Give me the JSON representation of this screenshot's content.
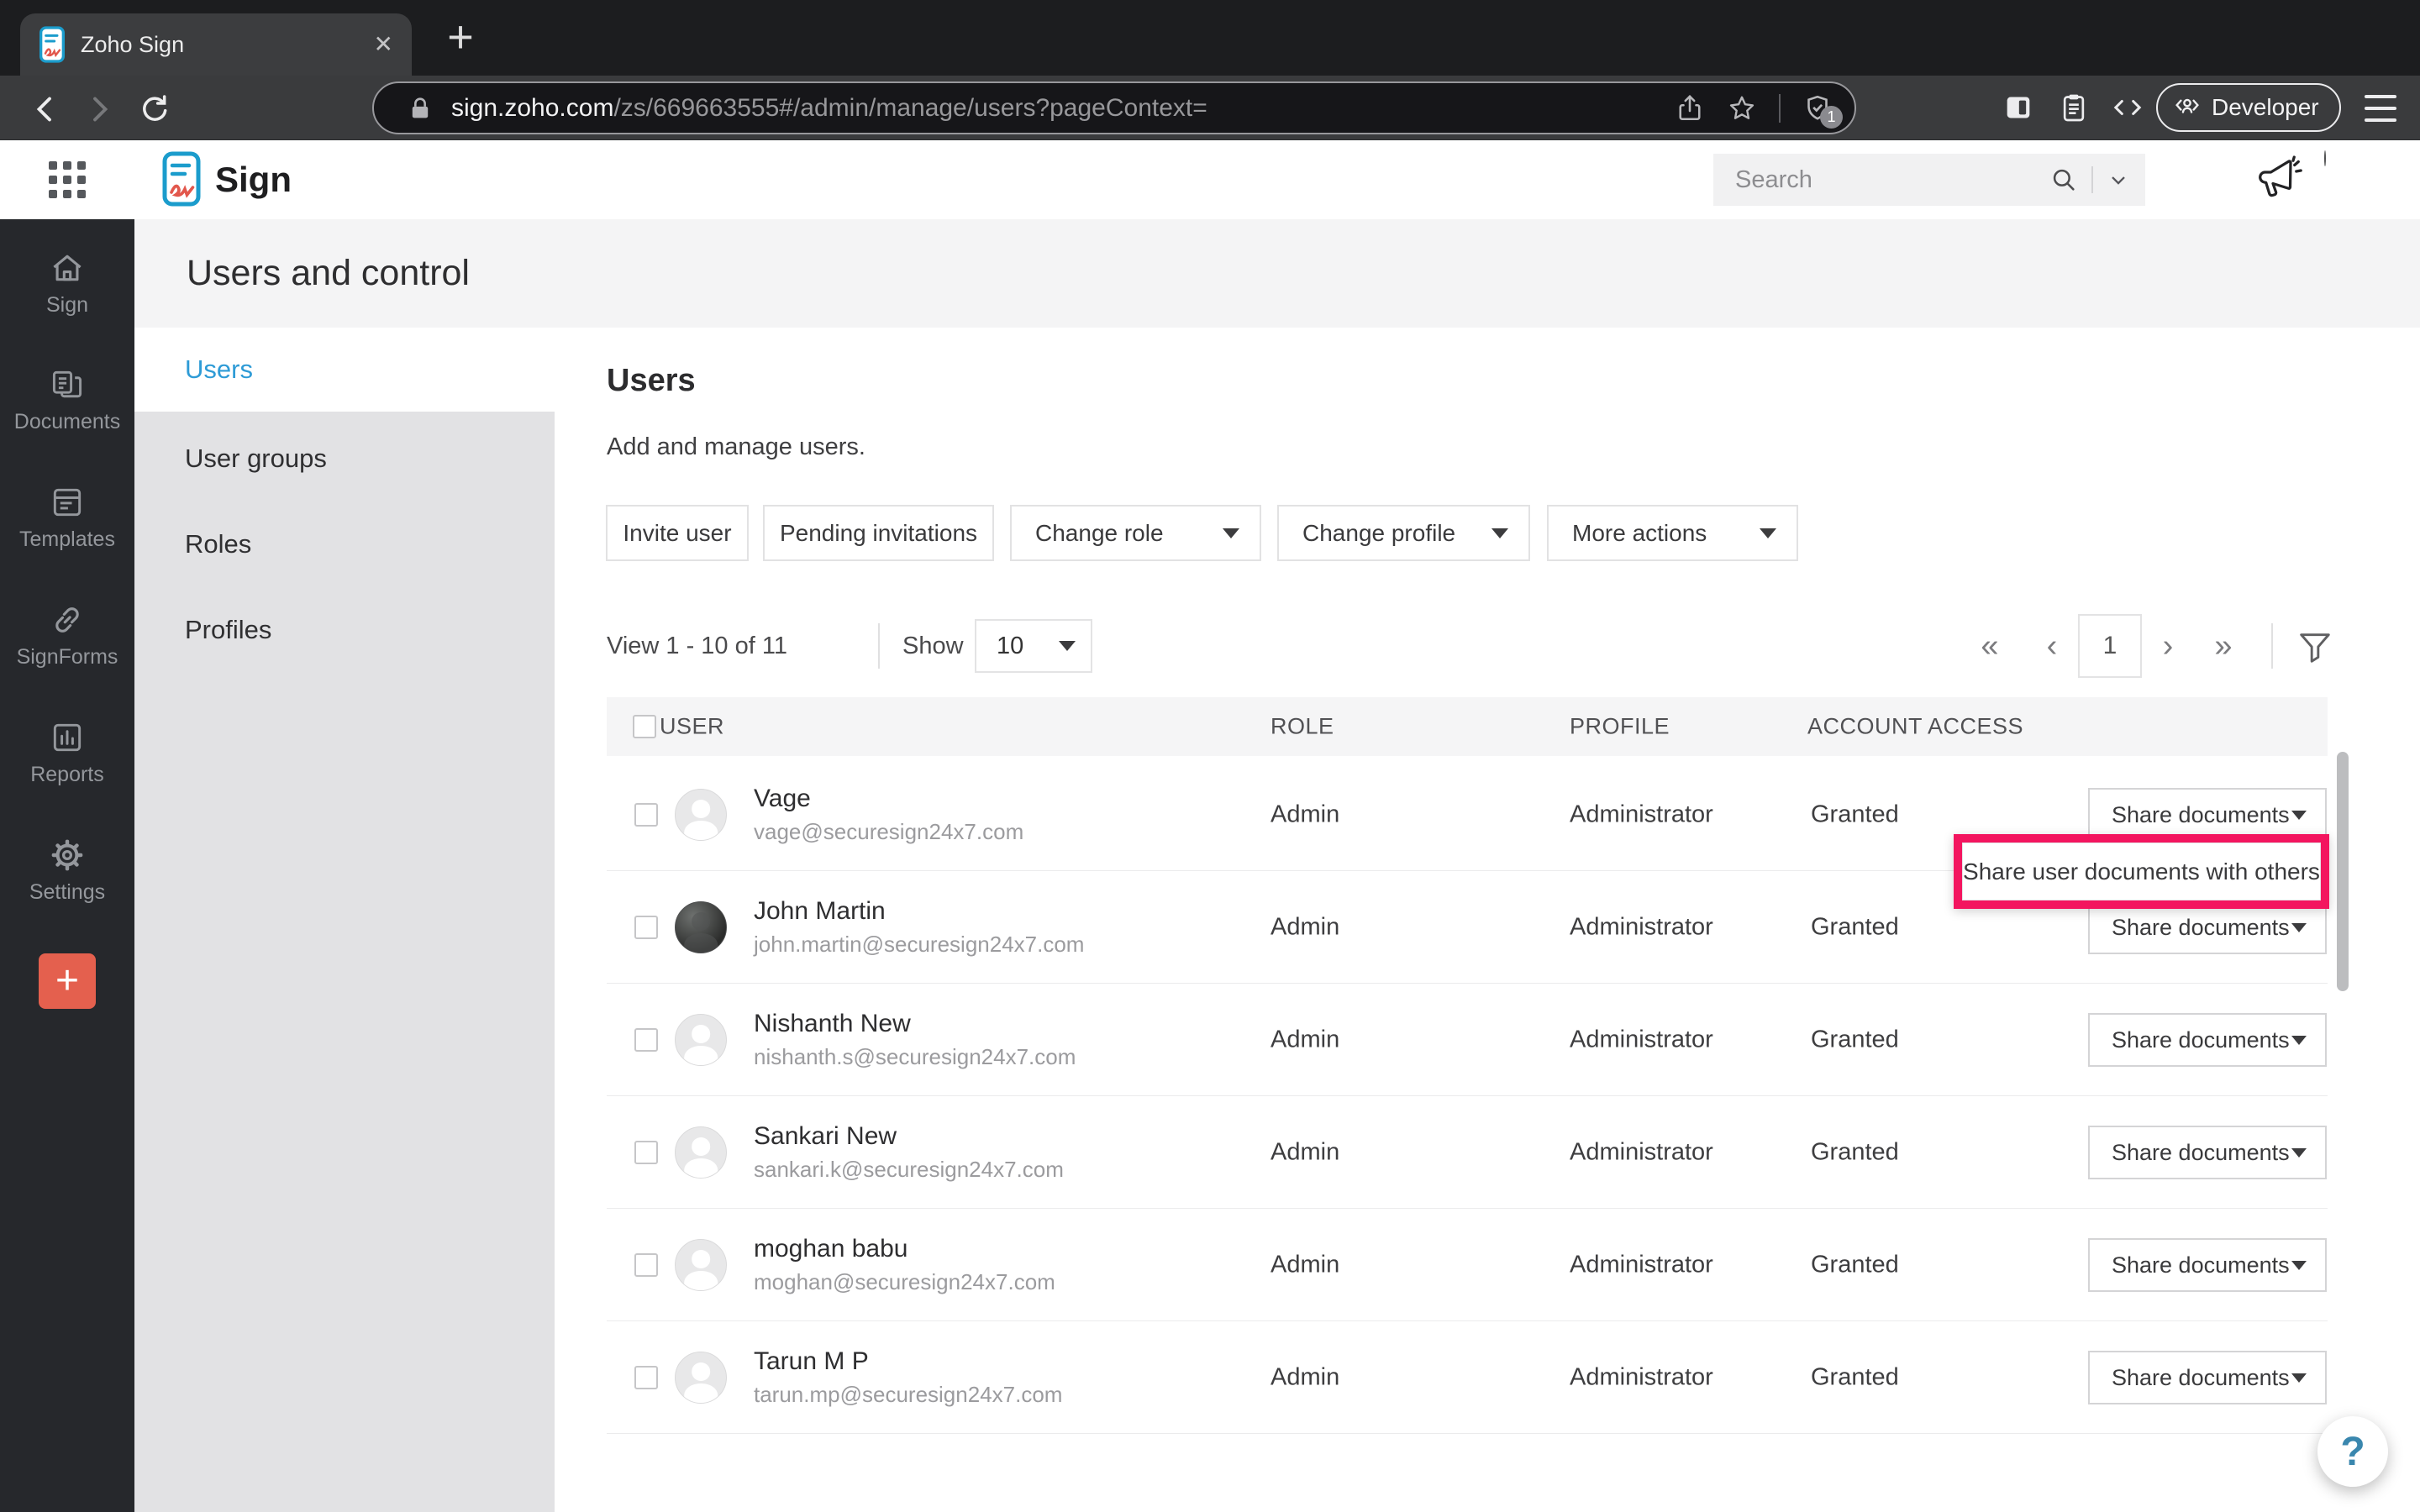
{
  "browser": {
    "tab_title": "Zoho Sign",
    "url": {
      "host": "sign.zoho.com",
      "path": "/zs/669663555#/admin/manage/users?pageContext="
    },
    "shield_badge": "1",
    "developer_button": "Developer"
  },
  "app_header": {
    "product": "Sign",
    "search_placeholder": "Search"
  },
  "nav_sidebar": {
    "items": [
      {
        "label": "Sign"
      },
      {
        "label": "Documents"
      },
      {
        "label": "Templates"
      },
      {
        "label": "SignForms"
      },
      {
        "label": "Reports"
      },
      {
        "label": "Settings"
      }
    ]
  },
  "page": {
    "title": "Users and control"
  },
  "settings_nav": {
    "items": [
      {
        "label": "Users",
        "active": true
      },
      {
        "label": "User groups"
      },
      {
        "label": "Roles"
      },
      {
        "label": "Profiles"
      }
    ]
  },
  "users_section": {
    "heading": "Users",
    "description": "Add and manage users.",
    "actions": {
      "invite": "Invite user",
      "pending": "Pending invitations",
      "change_role": "Change role",
      "change_profile": "Change profile",
      "more": "More actions"
    },
    "pagination": {
      "view_text": "View 1 - 10 of 11",
      "show_label": "Show",
      "page_size": "10",
      "page": "1"
    },
    "table": {
      "headers": {
        "user": "USER",
        "role": "ROLE",
        "profile": "PROFILE",
        "access": "ACCOUNT ACCESS"
      },
      "row_action": "Share documents",
      "rows": [
        {
          "name": "Vage",
          "email": "vage@securesign24x7.com",
          "role": "Admin",
          "profile": "Administrator",
          "access": "Granted",
          "photo": false
        },
        {
          "name": "John Martin",
          "email": "john.martin@securesign24x7.com",
          "role": "Admin",
          "profile": "Administrator",
          "access": "Granted",
          "photo": true
        },
        {
          "name": "Nishanth New",
          "email": "nishanth.s@securesign24x7.com",
          "role": "Admin",
          "profile": "Administrator",
          "access": "Granted",
          "photo": false
        },
        {
          "name": "Sankari New",
          "email": "sankari.k@securesign24x7.com",
          "role": "Admin",
          "profile": "Administrator",
          "access": "Granted",
          "photo": false
        },
        {
          "name": "moghan babu",
          "email": "moghan@securesign24x7.com",
          "role": "Admin",
          "profile": "Administrator",
          "access": "Granted",
          "photo": false
        },
        {
          "name": "Tarun M P",
          "email": "tarun.mp@securesign24x7.com",
          "role": "Admin",
          "profile": "Administrator",
          "access": "Granted",
          "photo": false
        }
      ]
    },
    "tooltip": "Share user documents with others",
    "help_label": "?"
  },
  "icons": {
    "first_page": "«",
    "prev_page": "‹",
    "next_page": "›",
    "last_page": "»",
    "new_tab": "+",
    "plus": "+",
    "tab_close": "✕"
  },
  "colors": {
    "accent_blue": "#2e9bd6",
    "brand_coral": "#e4604e",
    "highlight_pink": "#f3155f",
    "help_blue": "#3a87ae"
  }
}
